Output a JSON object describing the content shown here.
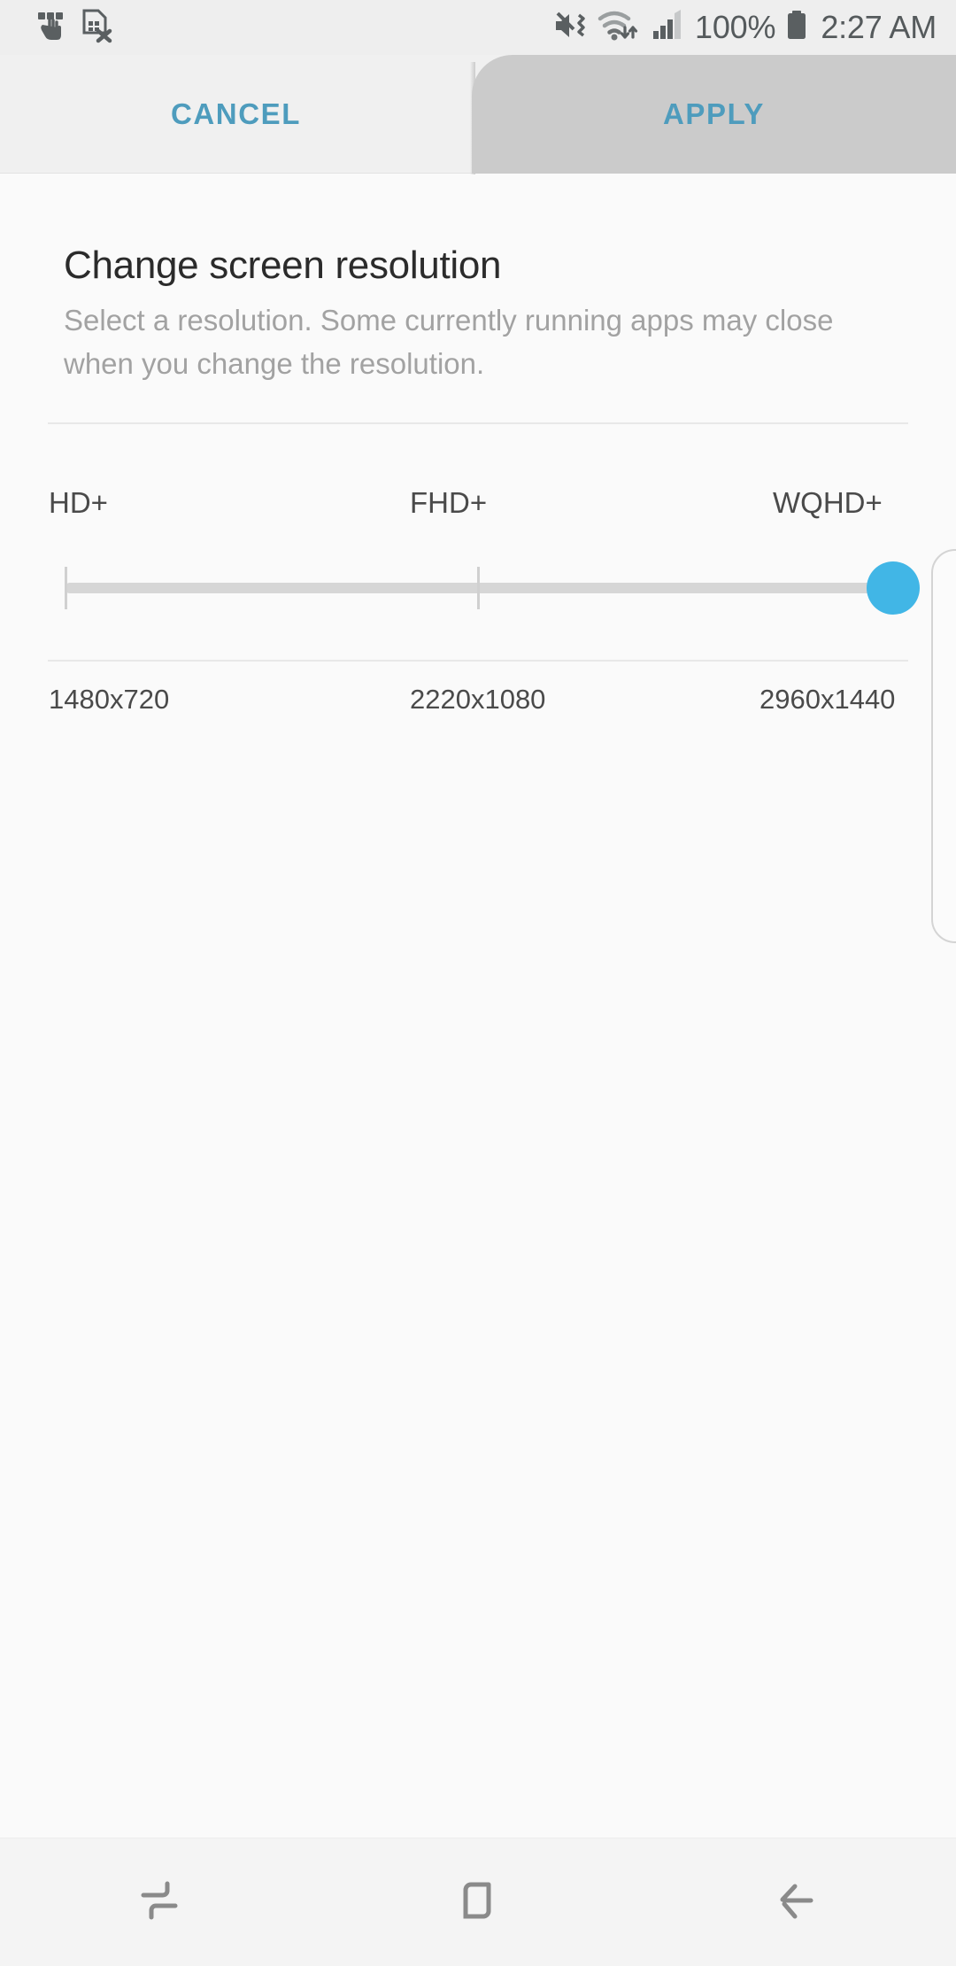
{
  "status_bar": {
    "left_icons": [
      {
        "name": "one-handed-gesture-icon",
        "label": "One-handed operation"
      },
      {
        "name": "no-sim-card-icon",
        "label": "No SIM card"
      }
    ],
    "right_icons": [
      {
        "name": "mute-vibrate-icon",
        "label": "Sound off / vibrate"
      },
      {
        "name": "wifi-transfer-icon",
        "label": "Wi-Fi connected"
      },
      {
        "name": "signal-bars-icon",
        "label": "Mobile signal"
      }
    ],
    "battery_percent": "100%",
    "battery_icon": "battery-full-icon",
    "clock": "2:27 AM"
  },
  "action_bar": {
    "cancel_label": "CANCEL",
    "apply_label": "APPLY",
    "accent_color": "#4e9cbd",
    "pressed_background": "#cbcbcb"
  },
  "main": {
    "title": "Change screen resolution",
    "description": "Select a resolution. Some currently running apps may close when you change the resolution.",
    "slider": {
      "tier_labels": [
        "HD+",
        "FHD+",
        "WQHD+"
      ],
      "resolution_labels": [
        "1480x720",
        "2220x1080",
        "2960x1440"
      ],
      "selected_index": 2,
      "selected_tier": "WQHD+",
      "selected_resolution": "2960x1440",
      "thumb_color": "#41b6e6",
      "track_color": "#d6d6d6"
    }
  },
  "edge_panel": {
    "handle_name": "edge-panel-handle"
  },
  "nav_bar": {
    "buttons": [
      {
        "name": "recents-button",
        "label": "Recents"
      },
      {
        "name": "home-button",
        "label": "Home"
      },
      {
        "name": "back-button",
        "label": "Back"
      }
    ]
  }
}
